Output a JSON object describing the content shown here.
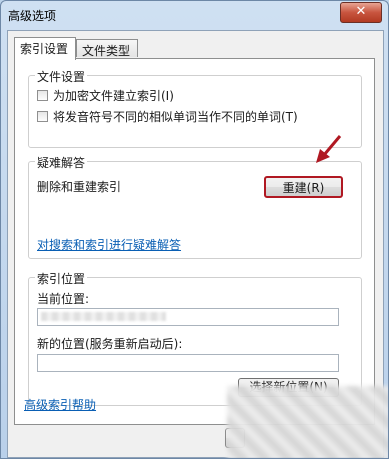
{
  "window": {
    "title": "高级选项",
    "close_label": "✕"
  },
  "tabs": [
    {
      "label": "索引设置"
    },
    {
      "label": "文件类型"
    }
  ],
  "file_settings": {
    "legend": "文件设置",
    "options": [
      {
        "label": "为加密文件建立索引(I)",
        "checked": false
      },
      {
        "label": "将发音符号不同的相似单词当作不同的单词(T)",
        "checked": false
      }
    ]
  },
  "troubleshoot": {
    "legend": "疑难解答",
    "rebuild_text": "删除和重建索引",
    "rebuild_button": "重建(R)",
    "link": "对搜索和索引进行疑难解答"
  },
  "index_location": {
    "legend": "索引位置",
    "current_label": "当前位置:",
    "new_label": "新的位置(服务重新启动后):",
    "select_button": "选择新位置(N)"
  },
  "help_link": "高级索引帮助",
  "colors": {
    "highlight": "#b01822",
    "link": "#0a5fb4"
  }
}
